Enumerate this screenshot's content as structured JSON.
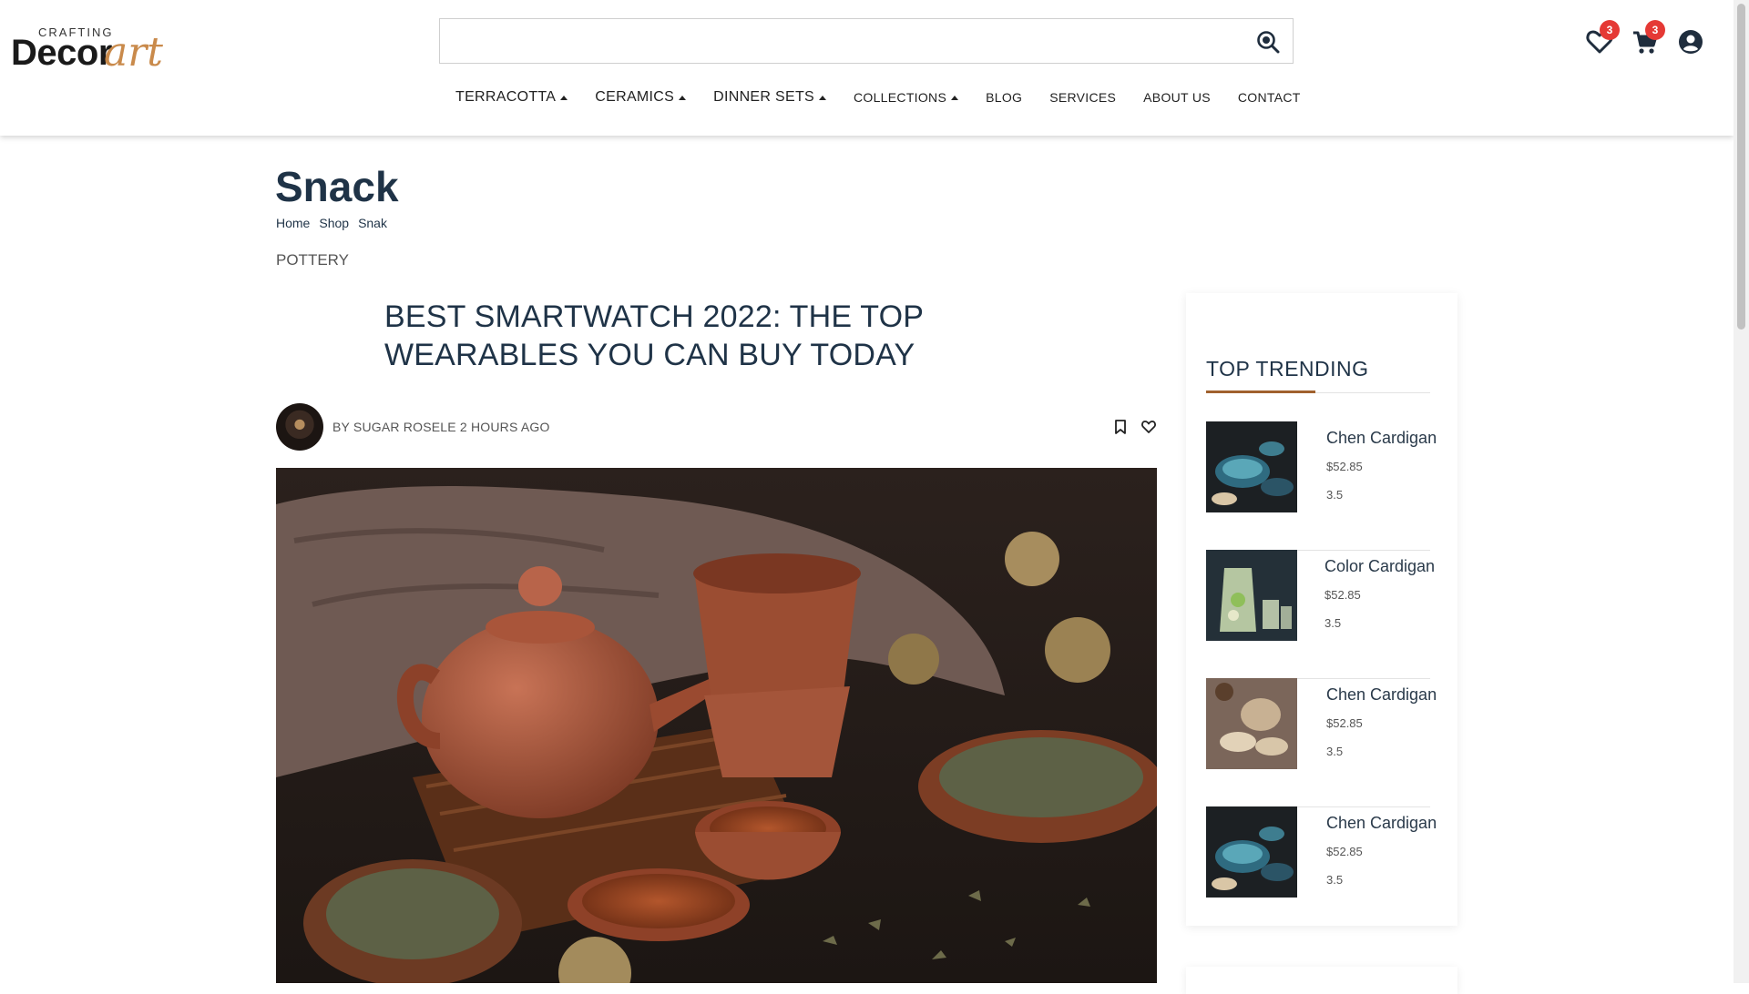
{
  "header": {
    "logo": {
      "small": "CRAFTING",
      "main": "Decor",
      "script": "art"
    },
    "search": {
      "placeholder": "",
      "value": ""
    },
    "nav": [
      {
        "label": "TERRACOTTA",
        "dropdown": true
      },
      {
        "label": "CERAMICS",
        "dropdown": true
      },
      {
        "label": "DINNER SETS",
        "dropdown": true
      },
      {
        "label": "COLLECTIONS",
        "dropdown": true
      },
      {
        "label": "BLOG",
        "dropdown": false
      },
      {
        "label": "SERVICES",
        "dropdown": false
      },
      {
        "label": "ABOUT US",
        "dropdown": false
      },
      {
        "label": "CONTACT",
        "dropdown": false
      }
    ],
    "wishlist_count": "3",
    "cart_count": "3"
  },
  "page": {
    "title": "Snack",
    "breadcrumb": [
      "Home",
      "Shop",
      "Snak"
    ],
    "category": "POTTERY"
  },
  "post": {
    "title": "BEST SMARTWATCH 2022: THE TOP WEARABLES YOU CAN BUY TODAY",
    "byline": "BY SUGAR ROSELE 2 HOURS AGO"
  },
  "sidebar": {
    "title": "TOP TRENDING",
    "items": [
      {
        "name": "Chen Cardigan",
        "price": "$52.85",
        "rating": "3.5"
      },
      {
        "name": "Color Cardigan",
        "price": "$52.85",
        "rating": "3.5"
      },
      {
        "name": "Chen Cardigan",
        "price": "$52.85",
        "rating": "3.5"
      },
      {
        "name": "Chen Cardigan",
        "price": "$52.85",
        "rating": "3.5"
      }
    ]
  },
  "colors": {
    "accent": "#a0612d",
    "badge": "#e53935",
    "heading": "#1f3347"
  },
  "icons": [
    "search-icon",
    "heart-icon",
    "cart-icon",
    "user-icon",
    "bookmark-icon",
    "like-icon"
  ]
}
